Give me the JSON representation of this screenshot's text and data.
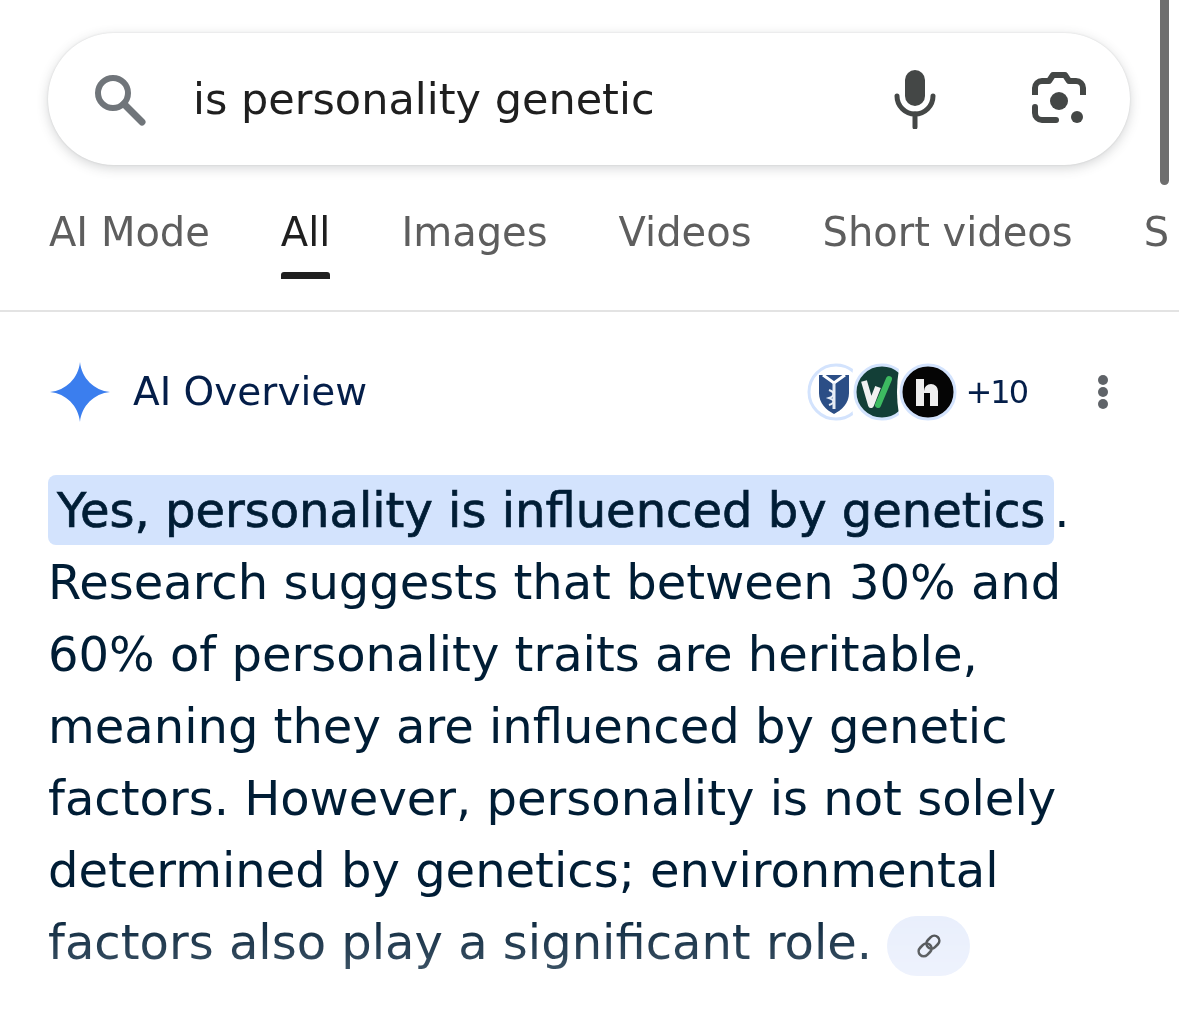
{
  "search": {
    "query": "is personality genetic"
  },
  "tabs": [
    {
      "label": "AI Mode",
      "selected": false
    },
    {
      "label": "All",
      "selected": true
    },
    {
      "label": "Images",
      "selected": false
    },
    {
      "label": "Videos",
      "selected": false
    },
    {
      "label": "Short videos",
      "selected": false
    },
    {
      "label": "S",
      "selected": false
    }
  ],
  "overview": {
    "title": "AI Overview",
    "sources_more": "+10",
    "answer": "**Yes, personality is influenced by genetics**. Research suggests that between 30% and 60% of personality traits are heritable, meaning they are influenced by genetic factors. However, personality is not solely determined by genetics; environmental factors also play a significant role."
  }
}
